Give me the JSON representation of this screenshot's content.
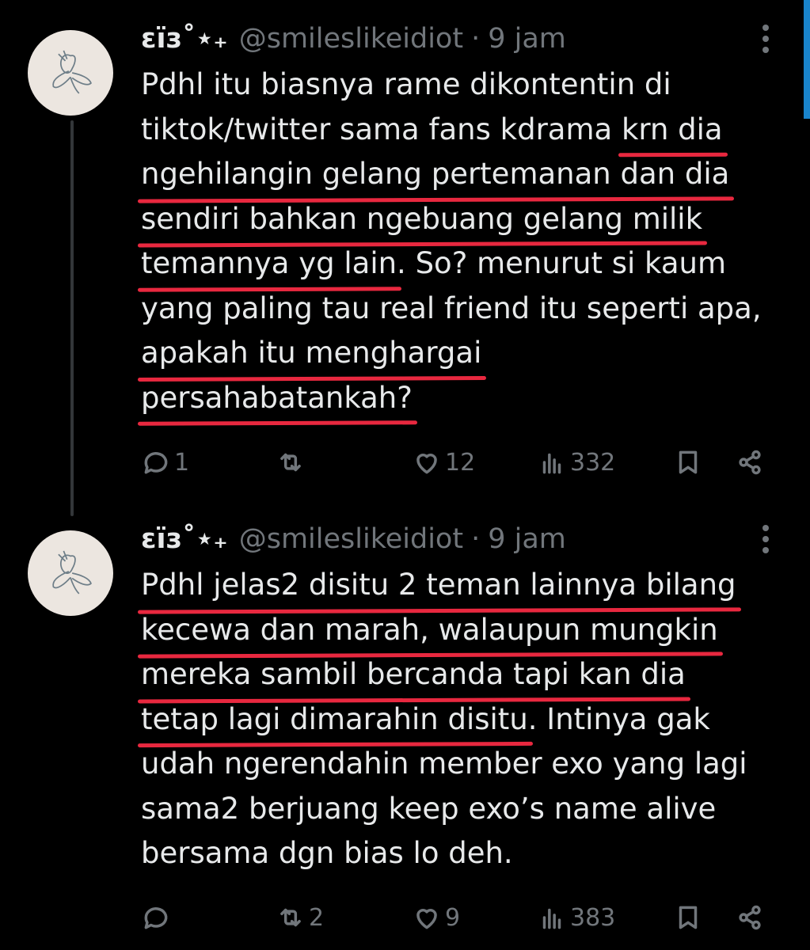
{
  "tweets": [
    {
      "display_name": "εïз˚⋆₊",
      "handle": "@smileslikeidiot",
      "separator": "·",
      "time": "9 jam",
      "lines": [
        [
          {
            "t": "Pdhl itu biasnya rame dikontentin di"
          }
        ],
        [
          {
            "t": "tiktok/twitter sama fans kdrama "
          },
          {
            "t": "krn dia",
            "u": true
          }
        ],
        [
          {
            "t": "ngehilangin gelang pertemanan dan dia",
            "u": true
          }
        ],
        [
          {
            "t": "sendiri bahkan ngebuang gelang milik",
            "u": true
          }
        ],
        [
          {
            "t": "temannya yg lain",
            "u": true
          },
          {
            "t": ". So? menurut si kaum"
          }
        ],
        [
          {
            "t": "yang paling tau real friend itu seperti apa,"
          }
        ],
        [
          {
            "t": "apakah itu menghargai",
            "u": true
          }
        ],
        [
          {
            "t": "persahabatankah?",
            "u": true
          }
        ]
      ],
      "replies": "1",
      "retweets": "",
      "likes": "12",
      "views": "332"
    },
    {
      "display_name": "εïз˚⋆₊",
      "handle": "@smileslikeidiot",
      "separator": "·",
      "time": "9 jam",
      "lines": [
        [
          {
            "t": "Pdhl jelas2 disitu 2 teman lainnya bilang",
            "u": true
          }
        ],
        [
          {
            "t": "kecewa dan marah, walaupun mungkin",
            "u": true
          }
        ],
        [
          {
            "t": "mereka sambil bercanda tapi kan dia",
            "u": true
          }
        ],
        [
          {
            "t": "tetap lagi dimarahin disitu",
            "u": true
          },
          {
            "t": ". Intinya gak"
          }
        ],
        [
          {
            "t": "udah ngerendahin member exo yang lagi"
          }
        ],
        [
          {
            "t": "sama2 berjuang keep exo’s name alive"
          }
        ],
        [
          {
            "t": "bersama dgn bias lo deh."
          }
        ]
      ],
      "replies": "",
      "retweets": "2",
      "likes": "9",
      "views": "383"
    }
  ],
  "colors": {
    "background": "#000000",
    "text": "#e7e9ea",
    "muted": "#71767b",
    "underline": "#e8283f",
    "avatar_bg": "#ece6e0"
  },
  "icons": [
    "reply-icon",
    "retweet-icon",
    "like-icon",
    "views-icon",
    "bookmark-icon",
    "share-icon",
    "more-icon"
  ]
}
